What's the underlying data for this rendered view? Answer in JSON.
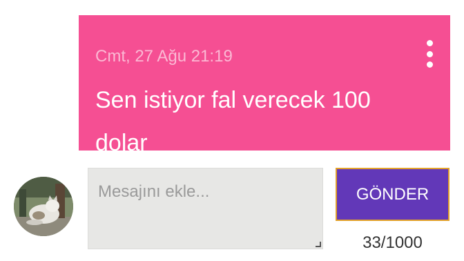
{
  "post": {
    "timestamp": "Cmt, 27 Ağu 21:19",
    "message": "Sen istiyor fal verecek 100 dolar",
    "menu_icon": "more-vertical-icon",
    "bubble_color": "#f54f93"
  },
  "composer": {
    "placeholder": "Mesajını ekle...",
    "value": "",
    "send_label": "GÖNDER",
    "send_color": "#6238b8",
    "counter": "33/1000"
  },
  "user": {
    "avatar_icon": "cat-photo-avatar"
  }
}
